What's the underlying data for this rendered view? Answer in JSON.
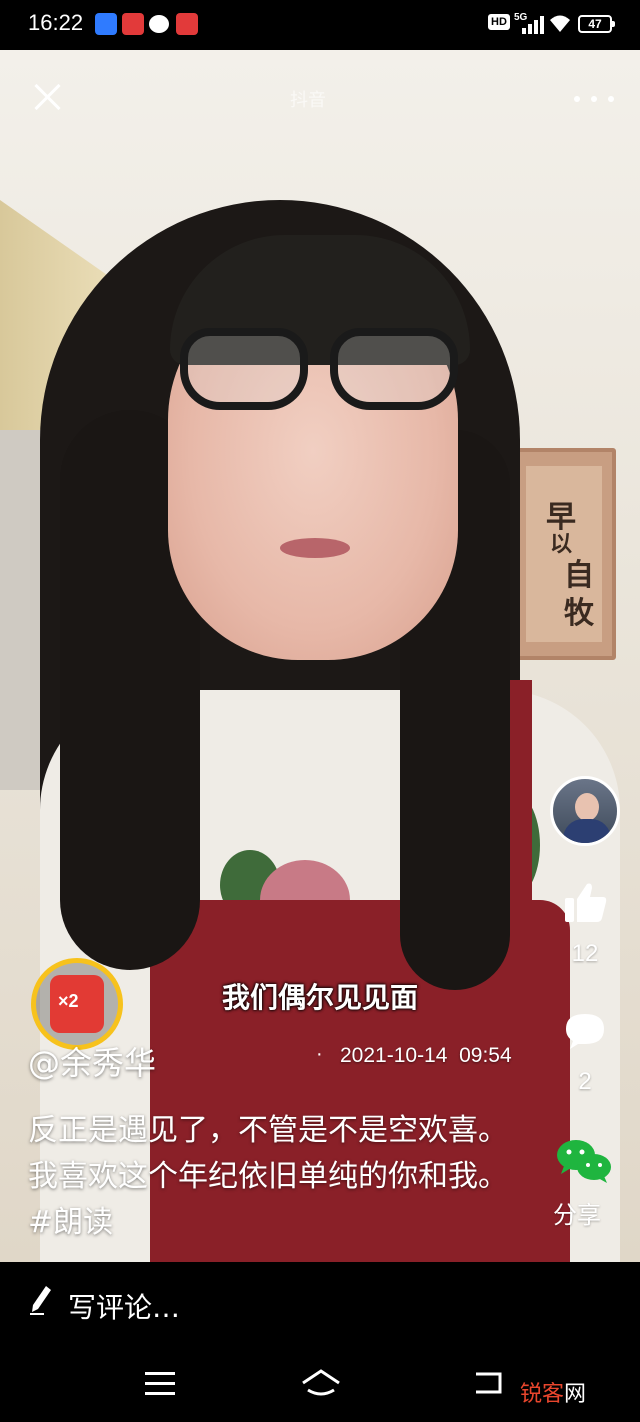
{
  "status_bar": {
    "time": "16:22",
    "hd_label": "HD",
    "network": "5G",
    "battery": "47"
  },
  "top_bar": {
    "watermark": "抖音"
  },
  "video": {
    "scroll_chars": [
      "早",
      "以",
      "自",
      "牧"
    ],
    "subtitle": "我们偶尔见见面"
  },
  "badge": {
    "multiplier": "×2",
    "ring_color": "#f7c21c",
    "packet_color": "#e23a34"
  },
  "post": {
    "author": "@余秀华",
    "separator": "·",
    "datetime": "2021-10-14  09:54",
    "caption": "反正是遇见了，不管是不是空欢喜。我喜欢这个年纪依旧单纯的你和我。#朗读"
  },
  "actions": {
    "likes": "12",
    "comments": "2",
    "share_label": "分享"
  },
  "comment_bar": {
    "placeholder": "写评论…"
  },
  "nav": {
    "site_logo_red": "锐客",
    "site_logo_white": "网"
  }
}
